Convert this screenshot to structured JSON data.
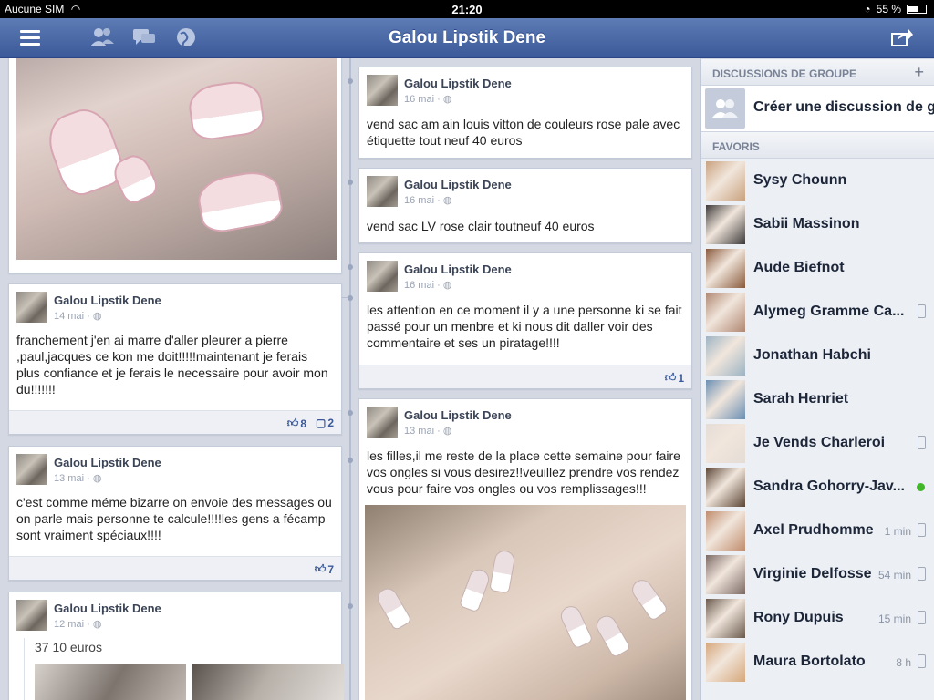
{
  "status_bar": {
    "carrier": "Aucune SIM",
    "time": "21:20",
    "battery": "55 %",
    "battery_level": 0.55
  },
  "nav": {
    "title": "Galou Lipstik Dene",
    "icons": [
      "menu-icon",
      "friend-requests-icon",
      "messages-icon",
      "notifications-globe-icon",
      "share-icon"
    ]
  },
  "feed": {
    "left": [
      {
        "author": "Galou Lipstik Dene",
        "date": "14 mai",
        "text": "franchement j'en ai marre d'aller pleurer a pierre ,paul,jacques ce kon me doit!!!!!maintenant je ferais plus confiance et je ferais le necessaire pour avoir mon du!!!!!!!",
        "likes": "8",
        "comments": "2"
      },
      {
        "author": "Galou Lipstik Dene",
        "date": "13 mai",
        "text": "c'est comme méme bizarre on envoie des messages ou on parle mais personne te calcule!!!!les gens a fécamp sont vraiment spéciaux!!!!",
        "likes": "7"
      },
      {
        "author": "Galou Lipstik Dene",
        "date": "12 mai",
        "text": "37 10 euros"
      }
    ],
    "right": [
      {
        "author": "Galou Lipstik Dene",
        "date": "16 mai",
        "text": "vend sac am ain louis vitton de couleurs rose pale avec étiquette tout neuf 40 euros"
      },
      {
        "author": "Galou Lipstik Dene",
        "date": "16 mai",
        "text": "vend sac LV rose clair toutneuf 40 euros"
      },
      {
        "author": "Galou Lipstik Dene",
        "date": "16 mai",
        "text": "les attention en ce moment il y a une personne ki se fait passé pour un menbre et ki nous dit daller voir des commentaire et ses un piratage!!!!",
        "likes": "1"
      },
      {
        "author": "Galou Lipstik Dene",
        "date": "13 mai",
        "text": "les filles,il me reste de la place cette semaine pour faire vos ongles si vous desirez!!veuillez prendre vos rendez vous pour faire vos ongles ou vos remplissages!!!"
      }
    ]
  },
  "sidebar": {
    "groups_header": "DISCUSSIONS DE GROUPE",
    "groups_add": "+",
    "create_group": "Créer une discussion de g",
    "favorites_header": "FAVORIS",
    "friends": [
      {
        "name": "Sysy Chounn",
        "ago": "",
        "status": "none",
        "color": "#c9a27e"
      },
      {
        "name": "Sabii Massinon",
        "ago": "",
        "status": "none",
        "color": "#3d3a3a"
      },
      {
        "name": "Aude Biefnot",
        "ago": "",
        "status": "none",
        "color": "#8a5a3c"
      },
      {
        "name": "Alymeg Gramme Ca...",
        "ago": "",
        "status": "mobile",
        "color": "#b08772"
      },
      {
        "name": "Jonathan Habchi",
        "ago": "",
        "status": "none",
        "color": "#9db4c4"
      },
      {
        "name": "Sarah Henriet",
        "ago": "",
        "status": "none",
        "color": "#6b8fb3"
      },
      {
        "name": "Je Vends Charleroi",
        "ago": "",
        "status": "mobile",
        "color": "#e4dcd6"
      },
      {
        "name": "Sandra Gohorry-Jav...",
        "ago": "",
        "status": "online",
        "color": "#5b4535"
      },
      {
        "name": "Axel Prudhomme",
        "ago": "1 min",
        "status": "mobile",
        "color": "#c08c6c"
      },
      {
        "name": "Virginie Delfosse",
        "ago": "54 min",
        "status": "mobile",
        "color": "#7c6a65"
      },
      {
        "name": "Rony Dupuis",
        "ago": "15 min",
        "status": "mobile",
        "color": "#6a5a4d"
      },
      {
        "name": "Maura Bortolato",
        "ago": "8 h",
        "status": "mobile",
        "color": "#d6a77a"
      }
    ]
  }
}
